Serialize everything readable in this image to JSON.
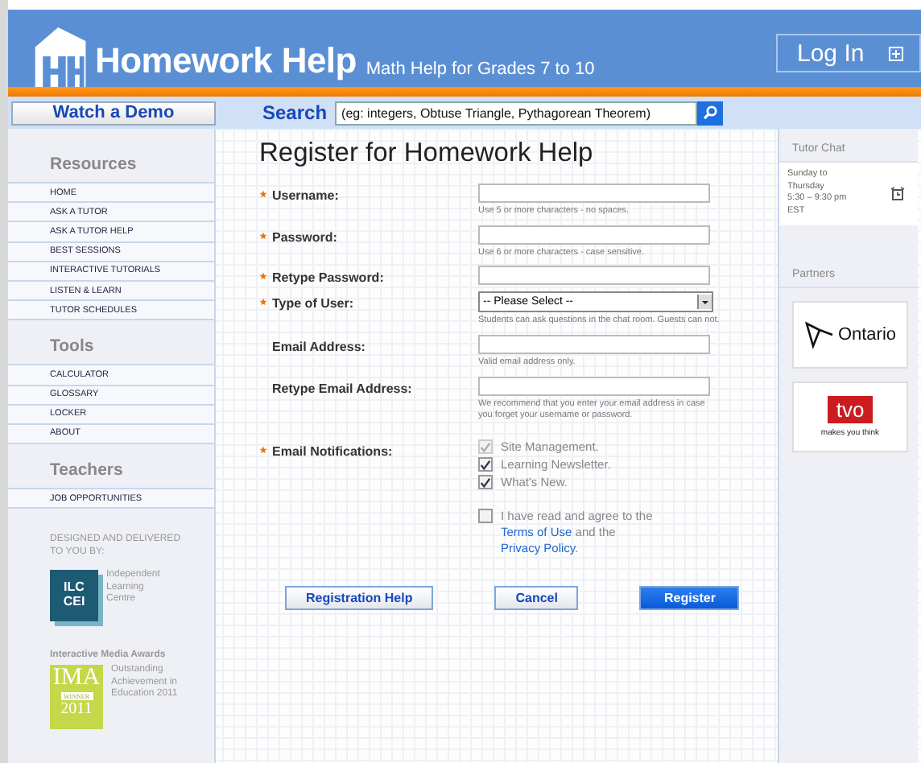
{
  "header": {
    "logo_text": "Homework Help",
    "tagline": "Math Help for Grades 7 to 10",
    "login_button": "Log In"
  },
  "nav": {
    "demo_button": "Watch a Demo",
    "search_label": "Search",
    "search_placeholder": "(eg: integers, Obtuse Triangle, Pythagorean Theorem)"
  },
  "sidebar": {
    "sections": [
      {
        "title": "Resources",
        "items": [
          "HOME",
          "ASK A TUTOR",
          "ASK A TUTOR HELP",
          "BEST SESSIONS",
          "INTERACTIVE TUTORIALS",
          "LISTEN & LEARN",
          "TUTOR SCHEDULES"
        ]
      },
      {
        "title": "Tools",
        "items": [
          "CALCULATOR",
          "GLOSSARY",
          "LOCKER",
          "ABOUT"
        ]
      },
      {
        "title": "Teachers",
        "items": [
          "JOB OPPORTUNITIES"
        ]
      }
    ],
    "credit": "DESIGNED AND DELIVERED TO YOU BY:",
    "ilc_logo": [
      "ILC",
      "CEI"
    ],
    "ilc_name": "Independent Learning Centre",
    "award_title": "Interactive Media Awards",
    "award_logo": {
      "title": "IMA",
      "ribbon": "WINNER",
      "year": "2011"
    },
    "award_text": "Outstanding Achievement in Education 2011"
  },
  "form": {
    "title": "Register for Homework Help",
    "fields": [
      {
        "kind": "text",
        "label": "Username:",
        "required": true,
        "hint": "Use 5 or more characters - no spaces."
      },
      {
        "kind": "text",
        "label": "Password:",
        "required": true,
        "hint": "Use 6 or more characters - case sensitive."
      },
      {
        "kind": "text",
        "label": "Retype Password:",
        "required": true
      },
      {
        "kind": "select",
        "label": "Type of User:",
        "required": true,
        "value": "-- Please Select --",
        "hint": "Students can ask questions in the chat room. Guests can not."
      },
      {
        "kind": "text",
        "label": "Email Address:",
        "required": false,
        "hint": "Valid email address only."
      },
      {
        "kind": "text",
        "label": "Retype Email Address:",
        "required": false,
        "hint": "We recommend that you enter your email address in case you forget your username or password."
      }
    ],
    "notifications": {
      "label": "Email Notifications:",
      "required": true,
      "options": [
        {
          "label": "Site Management.",
          "checked": true,
          "disabled": true
        },
        {
          "label": "Learning Newsletter.",
          "checked": true,
          "disabled": false
        },
        {
          "label": "What's New.",
          "checked": true,
          "disabled": false
        }
      ]
    },
    "agree": {
      "checked": false,
      "before": "I have read and agree to the",
      "terms_link": "Terms of Use",
      "middle": "and the",
      "privacy_link": "Privacy Policy",
      "after": "."
    },
    "buttons": [
      {
        "label": "Registration Help",
        "primary": false
      },
      {
        "label": "Cancel",
        "primary": false
      },
      {
        "label": "Register",
        "primary": true
      }
    ]
  },
  "right": {
    "chat_title": "Tutor Chat",
    "chat_hours": [
      "Sunday to",
      "Thursday",
      "5:30 – 9:30 pm",
      "EST"
    ],
    "partners_title": "Partners",
    "ontario": "Ontario",
    "tvo": "tvo",
    "tvo_tagline": "makes you think"
  }
}
